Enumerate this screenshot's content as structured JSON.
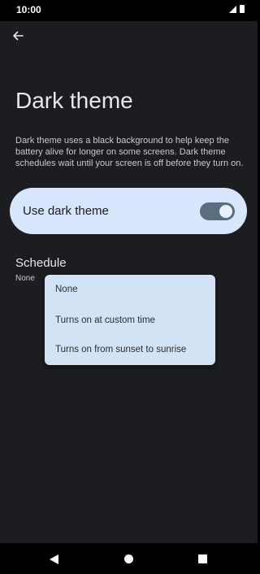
{
  "status_bar": {
    "time": "10:00",
    "icons": [
      "signal-icon",
      "battery-icon"
    ]
  },
  "header": {
    "back_icon": "arrow-left-icon"
  },
  "page": {
    "title": "Dark theme",
    "description": "Dark theme uses a black background to help keep the battery alive for longer on some screens. Dark theme schedules wait until your screen is off before they turn on."
  },
  "toggle": {
    "label": "Use dark theme",
    "enabled": true
  },
  "schedule": {
    "title": "Schedule",
    "value": "None",
    "options": [
      "None",
      "Turns on at custom time",
      "Turns on from sunset to sunrise"
    ]
  },
  "nav_bar": {
    "icons": [
      "back-triangle-icon",
      "home-circle-icon",
      "recents-square-icon"
    ]
  },
  "colors": {
    "background": "#1c1d20",
    "card": "#d8e6fb",
    "switch_track": "#5a6e80",
    "dropdown": "#d3e3f6"
  }
}
